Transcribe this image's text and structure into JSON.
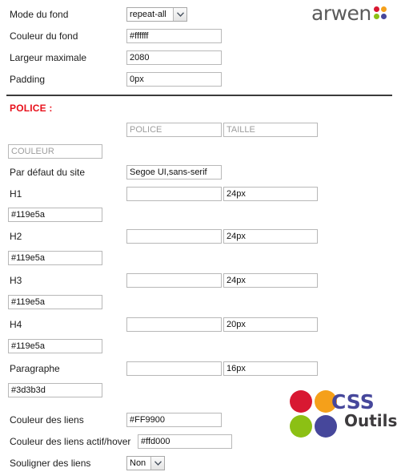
{
  "brand": {
    "arwen": {
      "wordmark": "arwen",
      "dots": [
        {
          "name": "dot-red",
          "color": "#d81832"
        },
        {
          "name": "dot-orange",
          "color": "#f5a01a"
        },
        {
          "name": "dot-green",
          "color": "#8cc014"
        },
        {
          "name": "dot-purple",
          "color": "#46479b"
        }
      ]
    },
    "cssoutils": {
      "css_text": "CSS",
      "outils_text": "Outils",
      "css_color": "#46479b",
      "outils_color": "#3d3b3d",
      "dots": [
        {
          "name": "dot-red",
          "color": "#d81832"
        },
        {
          "name": "dot-orange",
          "color": "#f5a01a"
        },
        {
          "name": "dot-green",
          "color": "#8cc014"
        },
        {
          "name": "dot-purple",
          "color": "#46479b"
        }
      ]
    }
  },
  "background_section": {
    "mode_label": "Mode du fond",
    "mode_value": "repeat-all",
    "color_label": "Couleur du fond",
    "color_value": "#ffffff",
    "maxwidth_label": "Largeur maximale",
    "maxwidth_value": "2080",
    "padding_label": "Padding",
    "padding_value": "0px"
  },
  "police_section": {
    "title": "POLICE :",
    "header_police": "POLICE",
    "header_taille": "TAILLE",
    "header_couleur": "COULEUR",
    "rows": [
      {
        "label": "Par défaut du site",
        "font": "Segoe UI,sans-serif",
        "size": "",
        "color": ""
      },
      {
        "label": "H1",
        "font": "",
        "size": "24px",
        "color": "#119e5a"
      },
      {
        "label": "H2",
        "font": "",
        "size": "24px",
        "color": "#119e5a"
      },
      {
        "label": "H3",
        "font": "",
        "size": "24px",
        "color": "#119e5a"
      },
      {
        "label": "H4",
        "font": "",
        "size": "20px",
        "color": "#119e5a"
      },
      {
        "label": "Paragraphe",
        "font": "",
        "size": "16px",
        "color": "#3d3b3d"
      }
    ]
  },
  "links_section": {
    "link_color_label": "Couleur des liens",
    "link_color_value": "#FF9900",
    "hover_color_label": "Couleur des liens actif/hover",
    "hover_color_value": "#ffd000",
    "underline_label": "Souligner des liens",
    "underline_value": "Non"
  }
}
